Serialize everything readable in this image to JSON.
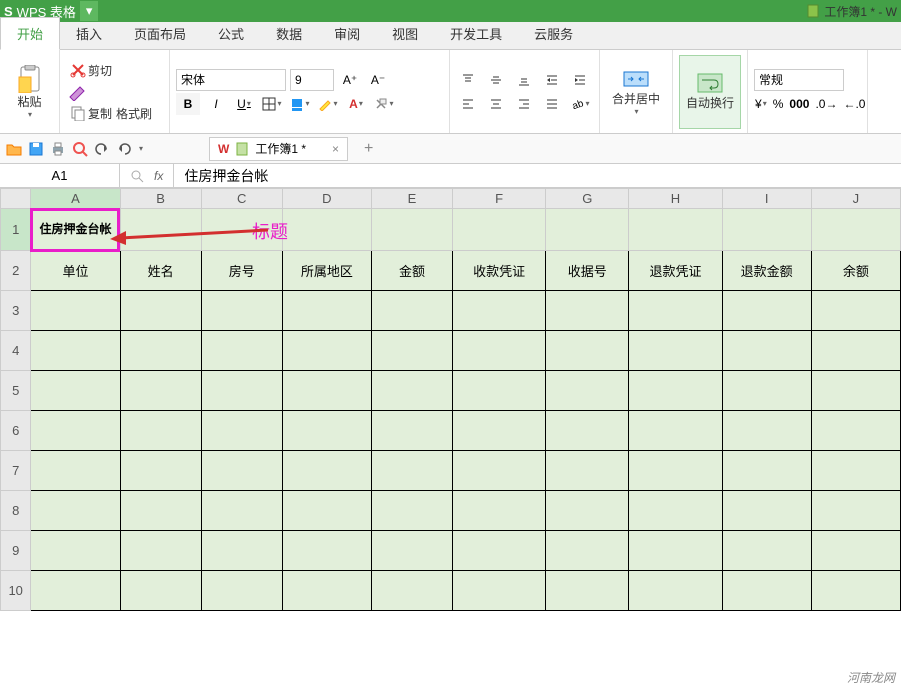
{
  "app": {
    "name": "WPS 表格",
    "doc_title": "工作簿1 * - W",
    "doc_icon_label": "📄"
  },
  "menu": {
    "tabs": [
      "开始",
      "插入",
      "页面布局",
      "公式",
      "数据",
      "审阅",
      "视图",
      "开发工具",
      "云服务"
    ],
    "active": "开始"
  },
  "ribbon": {
    "paste": "粘贴",
    "cut": "剪切",
    "copy": "复制",
    "format_painter": "格式刷",
    "font_name": "宋体",
    "font_size": "9",
    "merge_center": "合并居中",
    "wrap_text": "自动换行",
    "number_format": "常规"
  },
  "doc_tab": {
    "label": "工作簿1 *"
  },
  "name_box": "A1",
  "fx_symbol": "fx",
  "formula_value": "住房押金台帐",
  "columns": [
    "A",
    "B",
    "C",
    "D",
    "E",
    "F",
    "G",
    "H",
    "I",
    "J"
  ],
  "rows": [
    "1",
    "2",
    "3",
    "4",
    "5",
    "6",
    "7",
    "8",
    "9",
    "10"
  ],
  "cells": {
    "A1": "住房押金台帐",
    "headers": [
      "单位",
      "姓名",
      "房号",
      "所属地区",
      "金额",
      "收款凭证",
      "收据号",
      "退款凭证",
      "退款金额",
      "余额"
    ]
  },
  "annotation": {
    "label": "标题"
  },
  "watermark": "河南龙网"
}
